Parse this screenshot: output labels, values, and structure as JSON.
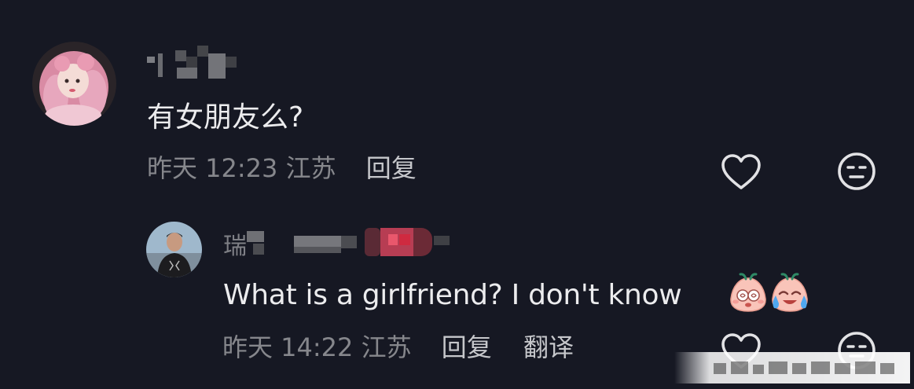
{
  "comments": [
    {
      "username": "",
      "text": "有女朋友么?",
      "time": "昨天 12:23",
      "location": "江苏",
      "reply_label": "回复"
    },
    {
      "username_visible": "瑞",
      "text": "What is a girlfriend? I don't know",
      "time": "昨天 14:22",
      "location": "江苏",
      "reply_label": "回复",
      "translate_label": "翻译"
    }
  ],
  "icons": {
    "like": "heart-outline-icon",
    "dislike": "unimpressed-face-icon",
    "emoji_1": "dizzy-face-emoji",
    "emoji_2": "crying-face-emoji"
  },
  "colors": {
    "background": "#161823",
    "primary_text": "#ececee",
    "secondary_text": "#86878c",
    "reply_text": "#c6c7cb"
  }
}
